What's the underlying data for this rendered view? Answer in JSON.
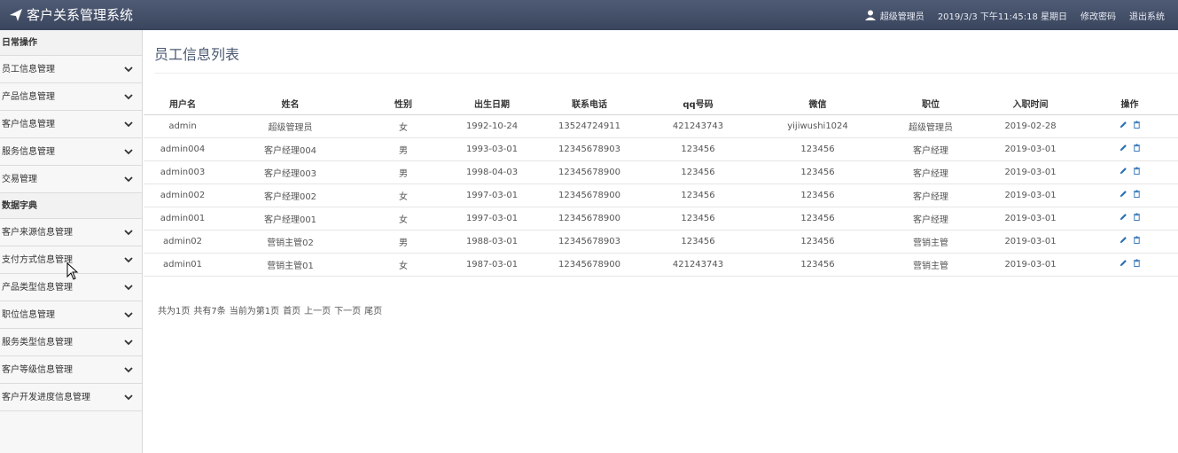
{
  "header": {
    "app_title": "客户关系管理系统",
    "user_name": "超级管理员",
    "datetime": "2019/3/3 下午11:45:18 星期日",
    "change_password": "修改密码",
    "logout": "退出系统"
  },
  "sidebar": {
    "section_daily": "日常操作",
    "daily_items": [
      "员工信息管理",
      "产品信息管理",
      "客户信息管理",
      "服务信息管理",
      "交易管理"
    ],
    "section_dict": "数据字典",
    "dict_items": [
      "客户来源信息管理",
      "支付方式信息管理",
      "产品类型信息管理",
      "职位信息管理",
      "服务类型信息管理",
      "客户等级信息管理",
      "客户开发进度信息管理"
    ]
  },
  "main": {
    "title": "员工信息列表",
    "columns": [
      "用户名",
      "姓名",
      "性别",
      "出生日期",
      "联系电话",
      "qq号码",
      "微信",
      "职位",
      "入职时间",
      "操作"
    ],
    "rows": [
      [
        "admin",
        "超级管理员",
        "女",
        "1992-10-24",
        "13524724911",
        "421243743",
        "yijiwushi1024",
        "超级管理员",
        "2019-02-28"
      ],
      [
        "admin004",
        "客户经理004",
        "男",
        "1993-03-01",
        "12345678903",
        "123456",
        "123456",
        "客户经理",
        "2019-03-01"
      ],
      [
        "admin003",
        "客户经理003",
        "男",
        "1998-04-03",
        "12345678900",
        "123456",
        "123456",
        "客户经理",
        "2019-03-01"
      ],
      [
        "admin002",
        "客户经理002",
        "女",
        "1997-03-01",
        "12345678900",
        "123456",
        "123456",
        "客户经理",
        "2019-03-01"
      ],
      [
        "admin001",
        "客户经理001",
        "女",
        "1997-03-01",
        "12345678900",
        "123456",
        "123456",
        "客户经理",
        "2019-03-01"
      ],
      [
        "admin02",
        "营销主管02",
        "男",
        "1988-03-01",
        "12345678903",
        "123456",
        "123456",
        "营销主管",
        "2019-03-01"
      ],
      [
        "admin01",
        "营销主管01",
        "女",
        "1987-03-01",
        "12345678900",
        "421243743",
        "123456",
        "营销主管",
        "2019-03-01"
      ]
    ],
    "pager": {
      "total_pages": "共为1页",
      "total_records": "共有7条",
      "current": "当前为第1页",
      "first": "首页",
      "prev": "上一页",
      "next": "下一页",
      "last": "尾页"
    }
  },
  "colors": {
    "topbar": "#3f4a63",
    "title": "#4b5a72",
    "icon": "#2a6fb6"
  }
}
